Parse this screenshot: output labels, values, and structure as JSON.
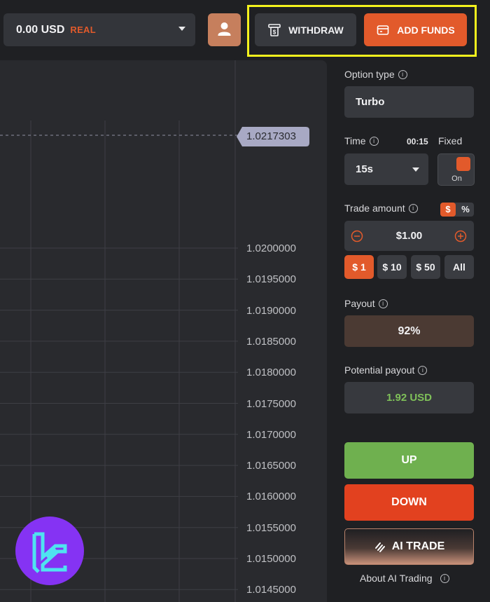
{
  "header": {
    "balance_amount": "0.00 USD",
    "balance_mode": "REAL",
    "withdraw_label": "WITHDRAW",
    "add_funds_label": "ADD FUNDS"
  },
  "chart": {
    "current_price": "1.0217303",
    "y_ticks": [
      "1.0200000",
      "1.0195000",
      "1.0190000",
      "1.0185000",
      "1.0180000",
      "1.0175000",
      "1.0170000",
      "1.0165000",
      "1.0160000",
      "1.0155000",
      "1.0150000",
      "1.0145000"
    ]
  },
  "panel": {
    "option_type_label": "Option type",
    "option_type_value": "Turbo",
    "time_label": "Time",
    "time_countdown": "00:15",
    "fixed_label": "Fixed",
    "time_value": "15s",
    "toggle_state": "On",
    "trade_amount_label": "Trade amount",
    "currency_symbol": "$",
    "percent_symbol": "%",
    "amount_value": "$1.00",
    "presets": [
      "$ 1",
      "$ 10",
      "$ 50",
      "All"
    ],
    "payout_label": "Payout",
    "payout_value": "92%",
    "potential_payout_label": "Potential payout",
    "potential_payout_value": "1.92 USD",
    "up_label": "UP",
    "down_label": "DOWN",
    "ai_trade_label": "AI TRADE",
    "about_ai_label": "About AI Trading"
  },
  "colors": {
    "accent_orange": "#e25a2b",
    "up_green": "#6fb04f",
    "down_red": "#e2411f",
    "highlight_yellow": "#f4f21d",
    "logo_purple": "#8533f3",
    "logo_cyan": "#4fe3f0"
  }
}
